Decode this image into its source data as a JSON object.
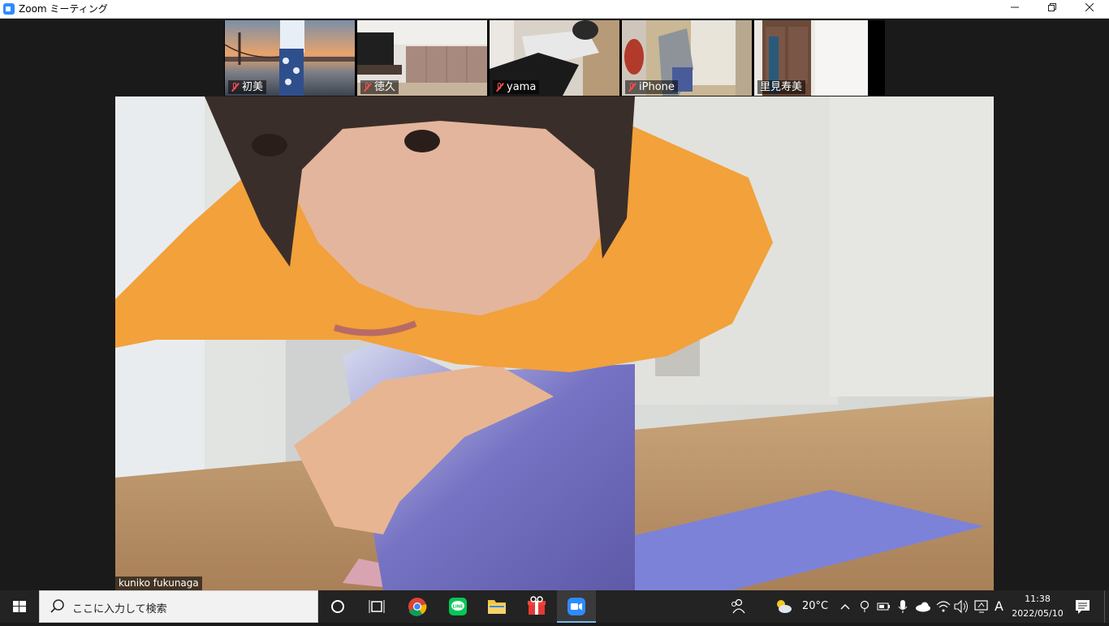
{
  "window": {
    "title": "Zoom ミーティング"
  },
  "participants": [
    {
      "name": "初美",
      "muted": true
    },
    {
      "name": "徳久",
      "muted": true
    },
    {
      "name": "yama",
      "muted": true
    },
    {
      "name": "iPhone",
      "muted": true
    },
    {
      "name": "里見寿美",
      "muted": false
    }
  ],
  "active_speaker": {
    "name": "kuniko fukunaga"
  },
  "taskbar": {
    "search_placeholder": "ここに入力して検索",
    "weather": "20°C",
    "ime": "A",
    "time": "11:38",
    "date": "2022/05/10"
  },
  "colors": {
    "accent": "#2d8cff",
    "mute": "#ff4d4d",
    "taskbar": "#232323"
  }
}
